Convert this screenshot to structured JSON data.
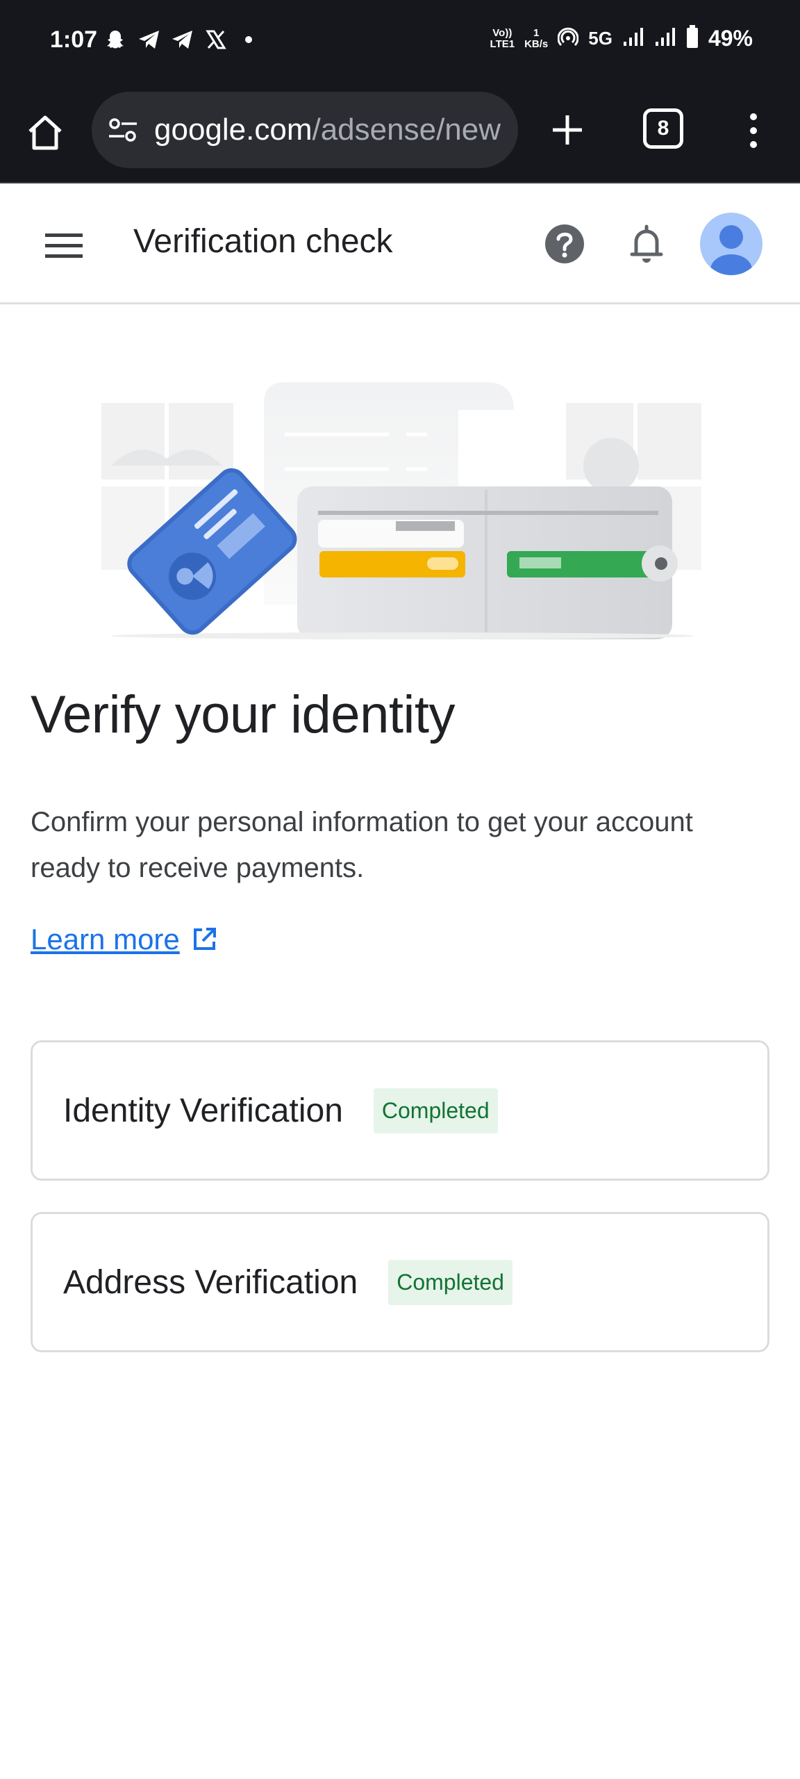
{
  "status_bar": {
    "time": "1:07",
    "volte_top": "Vo))",
    "volte_bottom": "LTE1",
    "speed_top": "1",
    "speed_bottom": "KB/s",
    "network": "5G",
    "battery": "49%",
    "icons": [
      "snapchat-icon",
      "telegram-icon",
      "telegram-icon",
      "x-icon",
      "dot-icon",
      "hotspot-icon",
      "signal-icon",
      "signal-icon",
      "battery-icon"
    ]
  },
  "browser": {
    "url_host": "google.com",
    "url_path": "/adsense/new",
    "tab_count": "8"
  },
  "header": {
    "title": "Verification check"
  },
  "main": {
    "heading": "Verify your identity",
    "description": "Confirm your personal information to get your account ready to receive payments.",
    "learn_more": "Learn more"
  },
  "cards": [
    {
      "title": "Identity Verification",
      "status": "Completed"
    },
    {
      "title": "Address Verification",
      "status": "Completed"
    }
  ],
  "colors": {
    "status_bar_bg": "#16171c",
    "link": "#1a73e8",
    "badge_bg": "#e6f4ea",
    "badge_text": "#137333",
    "avatar_bg": "#a8c7fa",
    "avatar_fg": "#4a7de0"
  }
}
